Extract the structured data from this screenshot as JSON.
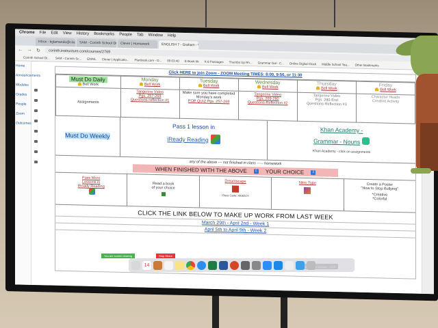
{
  "menubar": {
    "items": [
      "Chrome",
      "File",
      "Edit",
      "View",
      "History",
      "Bookmarks",
      "People",
      "Tab",
      "Window",
      "Help"
    ]
  },
  "tabs": [
    {
      "label": "Inbox - kglamando@cisd.k12"
    },
    {
      "label": "SAM - Corinth School District"
    },
    {
      "label": "Clever | Homework"
    },
    {
      "label": "ENGLISH 7 - Graham - W"
    }
  ],
  "url": "corinth.instructure.com/courses/2769",
  "bookmarks": [
    "Corinth School Di...",
    "SAM - Corinth Sc...",
    "EMAIL",
    "Clever | Applicatio...",
    "Planbook.com - O...",
    "00:03:40",
    "E-Book bk",
    "K-8 Passages",
    "Thumbs Up Rh...",
    "Grammar Gal - C...",
    "Online Digital Clock",
    "Middle School Tea...",
    "Other Bookmarks"
  ],
  "leftnav": [
    "Home",
    "Announcements",
    "Modules",
    "Grades",
    "People",
    "Zoom",
    "Outcomes"
  ],
  "zoom_line": "Click HERE to join Zoom - ZOOM Meeting TIMES: 8:00, 9:56, or 11:30",
  "must_do_daily": "Must Do Daily",
  "bell_work": "Bell Work",
  "assignments_label": "Assignments",
  "days": [
    {
      "name": "Monday",
      "bell": "Bell Work",
      "a1": "Tangerine Video",
      "a2": "Pgs. 257-269",
      "a3": "Questions-reflection #1"
    },
    {
      "name": "Tuesday",
      "bell": "Bell Work",
      "a1": "Make sure you have completed",
      "a2": "Monday's work",
      "a3": "POP QUIZ Pgs. 257-269"
    },
    {
      "name": "Wednesday",
      "bell": "Bell Work",
      "a1": "Tangerine Video",
      "a2": "Pgs. 269-280",
      "a3": "Questions-Reflection #2"
    },
    {
      "name": "Thursday",
      "bell": "Bell Work",
      "a1": "Tangerine Video",
      "a2": "Pgs. 280-End",
      "a3": "Questions-Reflection #3"
    },
    {
      "name": "Friday",
      "bell": "Bell Work",
      "a1": "Character Heads",
      "a2": "Creative Activity",
      "a3": ""
    }
  ],
  "must_do_weekly": "Must Do Weekly",
  "iready": {
    "line1": "Pass 1 lesson in",
    "line2": "iReady Reading"
  },
  "khan": {
    "line1": "Khan Academy -",
    "line2": "Grammar - Nouns",
    "note": "Khan Academy - click on assignments"
  },
  "any_line": "any of the above --- not finished in class ----- homework",
  "finished": {
    "left": "WHEN FINISHED WITH THE ABOVE",
    "right": "YOUR CHOICE"
  },
  "choices": [
    {
      "l1": "Pass More",
      "l2": "Lessons in",
      "l3": "iReady Reading"
    },
    {
      "l1": "Read a book",
      "l2": "of your choice",
      "l3": ""
    },
    {
      "l1": "Dreamscape",
      "l2": "",
      "l3": "Class Code: XKADCY"
    },
    {
      "l1": "Nitro Type",
      "l2": "",
      "l3": ""
    },
    {
      "l1": "Create a Poster",
      "l2": "\"How to Stop Bullying\"",
      "l3": "*Creative",
      "l4": "*Colorful"
    }
  ],
  "click_below": "CLICK THE LINK BELOW TO MAKE UP WORK FROM LAST WEEK",
  "weeks": [
    "March 29th - April 2nd - Week 1",
    "April 5th to April 9th - Week 2"
  ],
  "screenshare": {
    "sharing": "You are screen sharing",
    "stop": "Stop Share"
  },
  "dock_tooltip": "Talking: Betty Graham - GSD",
  "dock_date": "14",
  "colors": {
    "must_do": "#9fe39a",
    "finish_bar": "#f3b6b6",
    "link_red": "#b03030",
    "link_blue": "#2457b8",
    "green_day": "#5a8a2a"
  }
}
